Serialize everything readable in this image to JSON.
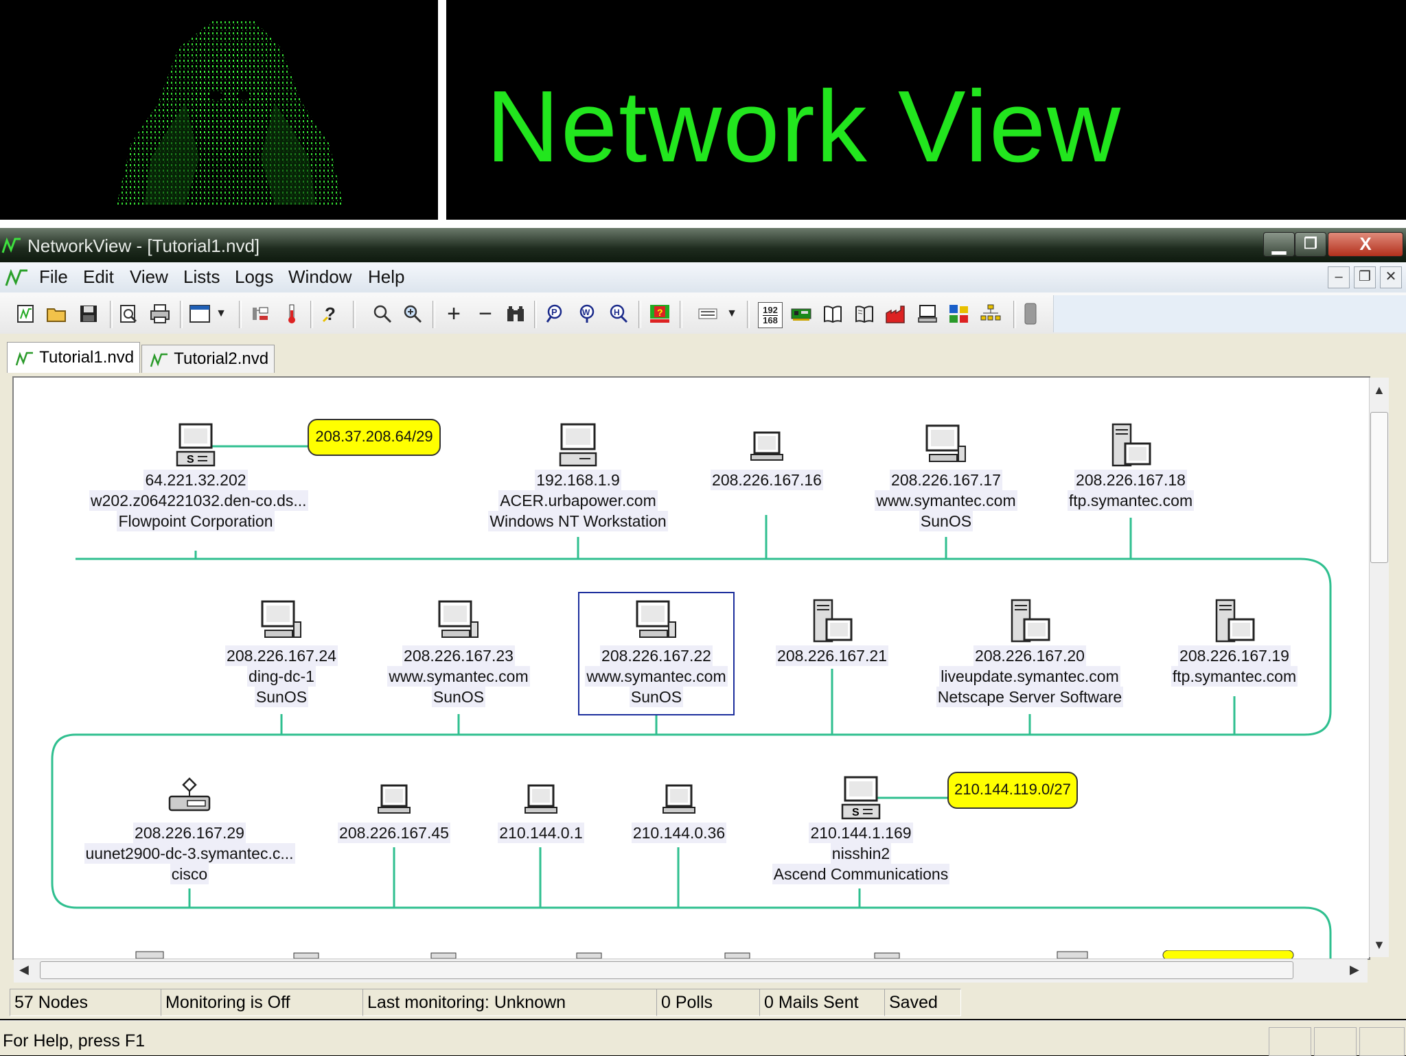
{
  "slide": {
    "title": "Network View"
  },
  "window": {
    "title": "NetworkView - [Tutorial1.nvd]",
    "minimize": "▁",
    "maximize": "❐",
    "close": "X"
  },
  "menu": {
    "items": [
      "File",
      "Edit",
      "View",
      "Lists",
      "Logs",
      "Window",
      "Help"
    ]
  },
  "tabs": [
    "Tutorial1.nvd",
    "Tutorial2.nvd"
  ],
  "toolbar": {
    "ip_button_top": "192",
    "ip_button_bottom": "168"
  },
  "nodes": [
    {
      "lines": [
        "64.221.32.202",
        "w202.z064221032.den-co.ds...",
        "Flowpoint Corporation"
      ],
      "icon": "router-server-icon"
    },
    {
      "lines": [
        "192.168.1.9",
        "ACER.urbapower.com",
        "Windows NT Workstation"
      ],
      "icon": "desktop-computer-icon"
    },
    {
      "lines": [
        "208.226.167.16"
      ],
      "icon": "laptop-icon"
    },
    {
      "lines": [
        "208.226.167.17",
        "www.symantec.com",
        "SunOS"
      ],
      "icon": "workstation-icon"
    },
    {
      "lines": [
        "208.226.167.18",
        "ftp.symantec.com"
      ],
      "icon": "server-icon"
    },
    {
      "lines": [
        "208.226.167.24",
        "ding-dc-1",
        "SunOS"
      ],
      "icon": "workstation-icon"
    },
    {
      "lines": [
        "208.226.167.23",
        "www.symantec.com",
        "SunOS"
      ],
      "icon": "workstation-icon"
    },
    {
      "lines": [
        "208.226.167.22",
        "www.symantec.com",
        "SunOS"
      ],
      "icon": "workstation-icon"
    },
    {
      "lines": [
        "208.226.167.21"
      ],
      "icon": "server-icon"
    },
    {
      "lines": [
        "208.226.167.20",
        "liveupdate.symantec.com",
        "Netscape Server Software"
      ],
      "icon": "server-icon"
    },
    {
      "lines": [
        "208.226.167.19",
        "ftp.symantec.com"
      ],
      "icon": "server-icon"
    },
    {
      "lines": [
        "208.226.167.29",
        "uunet2900-dc-3.symantec.c...",
        "cisco"
      ],
      "icon": "cisco-router-icon"
    },
    {
      "lines": [
        "208.226.167.45"
      ],
      "icon": "laptop-icon"
    },
    {
      "lines": [
        "210.144.0.1"
      ],
      "icon": "laptop-icon"
    },
    {
      "lines": [
        "210.144.0.36"
      ],
      "icon": "laptop-icon"
    },
    {
      "lines": [
        "210.144.1.169",
        "nisshin2",
        "Ascend Communications"
      ],
      "icon": "router-server-icon"
    }
  ],
  "subnets": [
    "208.37.208.64/29",
    "210.144.119.0/27"
  ],
  "status": {
    "nodes": "57 Nodes",
    "monitoring": "Monitoring is Off",
    "last_monitoring": "Last monitoring: Unknown",
    "polls": "0 Polls",
    "mails": "0 Mails Sent",
    "saved": "Saved",
    "help": "For Help, press F1"
  },
  "colors": {
    "title_green": "#22e61e",
    "bus_line": "#2fbf8f",
    "subnet_fill": "#ffff00",
    "selection": "#1c2e9c"
  }
}
